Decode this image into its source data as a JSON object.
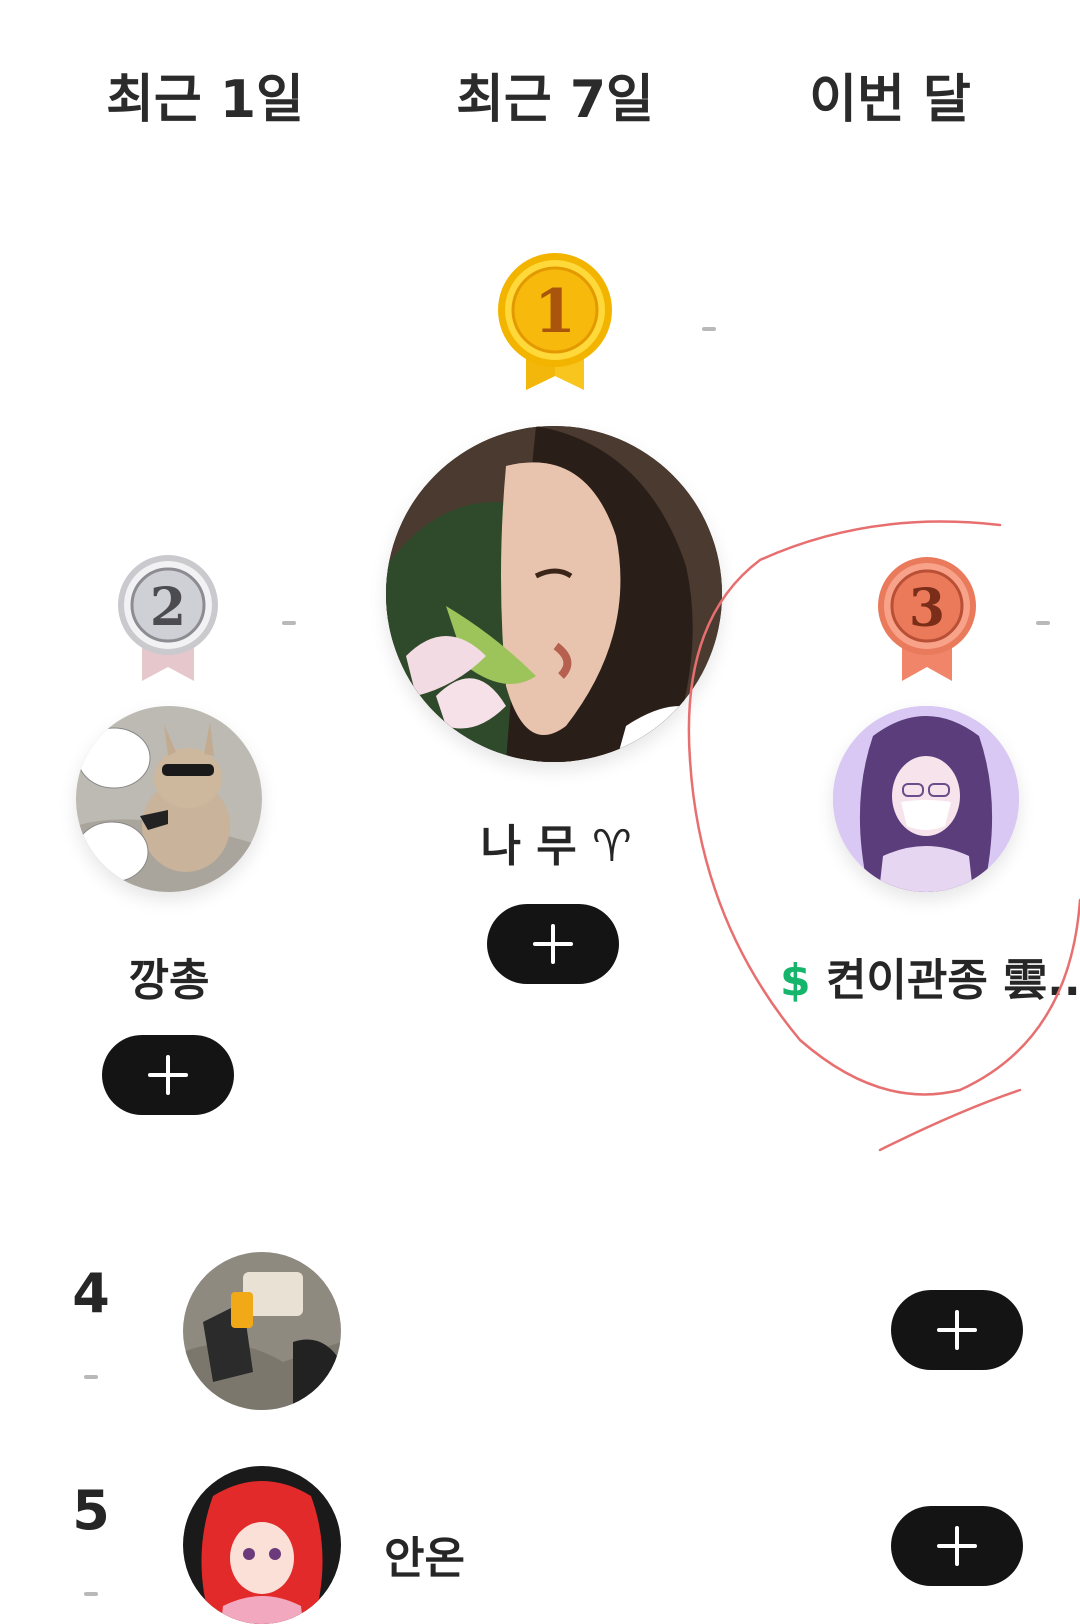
{
  "tabs": [
    {
      "label": "최근 1일"
    },
    {
      "label": "최근 7일"
    },
    {
      "label": "이번 달"
    }
  ],
  "podium": {
    "first": {
      "rank_badge": "1",
      "change": "-",
      "name": "나 무 ♈"
    },
    "second": {
      "rank_badge": "2",
      "change": "-",
      "name": "깡총"
    },
    "third": {
      "rank_badge": "3",
      "change": "-",
      "name_prefix": "$",
      "name": "켠이관종 雲..."
    }
  },
  "list": [
    {
      "rank": "4",
      "change": "-",
      "name": ""
    },
    {
      "rank": "5",
      "change": "-",
      "name": "안온"
    }
  ],
  "colors": {
    "gold": "#f5b400",
    "silver": "#b9b9bd",
    "bronze": "#e87a5b",
    "button": "#141414",
    "dollar": "#15b56b",
    "annotation": "#e86f6f"
  },
  "icons": {
    "follow": "plus-icon",
    "medal": "medal-icon"
  }
}
